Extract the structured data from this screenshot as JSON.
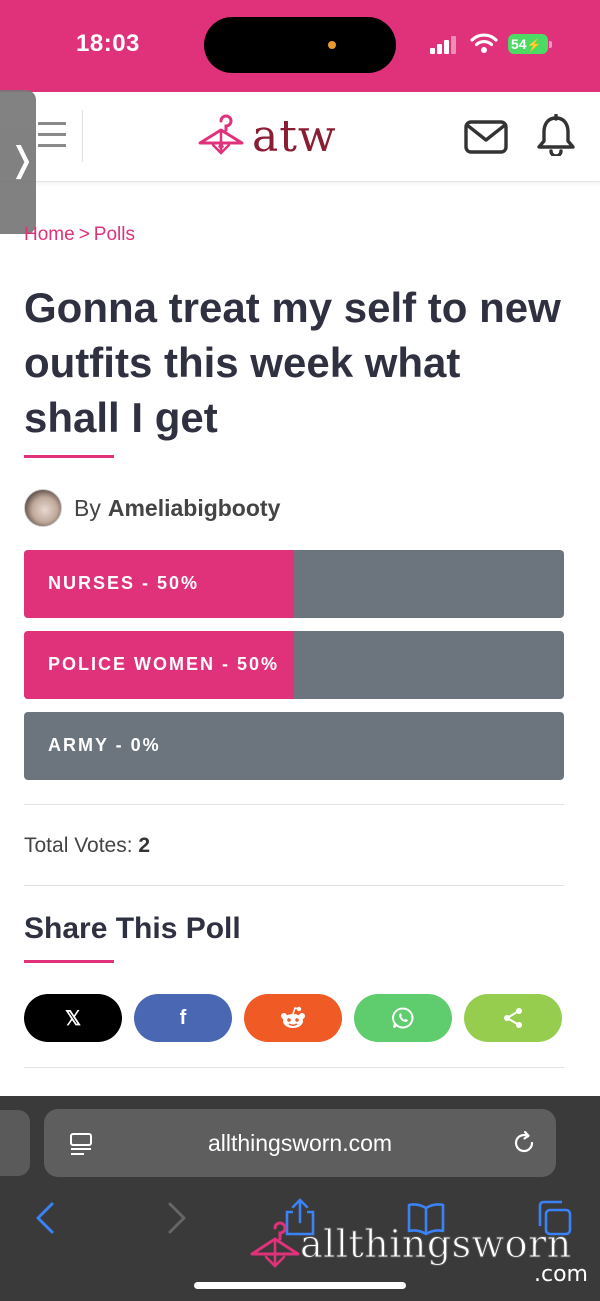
{
  "status_bar": {
    "time": "18:03",
    "battery": "54"
  },
  "header": {
    "logo_text": "atw"
  },
  "breadcrumb": {
    "home": "Home",
    "separator": ">",
    "current": "Polls"
  },
  "page_title": "Gonna treat my self to new outfits this week what shall I get",
  "author": {
    "by": "By",
    "name": "Ameliabigbooty"
  },
  "poll": {
    "options": [
      {
        "label": "NURSES - 50%",
        "percent": 50
      },
      {
        "label": "POLICE WOMEN - 50%",
        "percent": 50
      },
      {
        "label": "ARMY - 0%",
        "percent": 0
      }
    ],
    "total_votes_label": "Total Votes:",
    "total_votes": "2"
  },
  "share": {
    "title": "Share This Poll",
    "buttons": [
      {
        "name": "x-share-button",
        "icon": "x-logo-icon",
        "glyph": "𝕏",
        "color": "#000000"
      },
      {
        "name": "facebook-share-button",
        "icon": "facebook-icon",
        "glyph": "f",
        "color": "#4a67b3"
      },
      {
        "name": "reddit-share-button",
        "icon": "reddit-icon",
        "glyph": "",
        "color": "#f05a24"
      },
      {
        "name": "whatsapp-share-button",
        "icon": "whatsapp-icon",
        "glyph": "",
        "color": "#5fcc6e"
      },
      {
        "name": "generic-share-button",
        "icon": "share-icon",
        "glyph": "",
        "color": "#97cd4f"
      }
    ]
  },
  "browser": {
    "url": "allthingsworn.com"
  },
  "watermark": {
    "text": "allthingsworn",
    "suffix": ".com"
  },
  "colors": {
    "accent": "#e0317b",
    "bar_bg": "#6c757d",
    "title": "#2f3040"
  }
}
